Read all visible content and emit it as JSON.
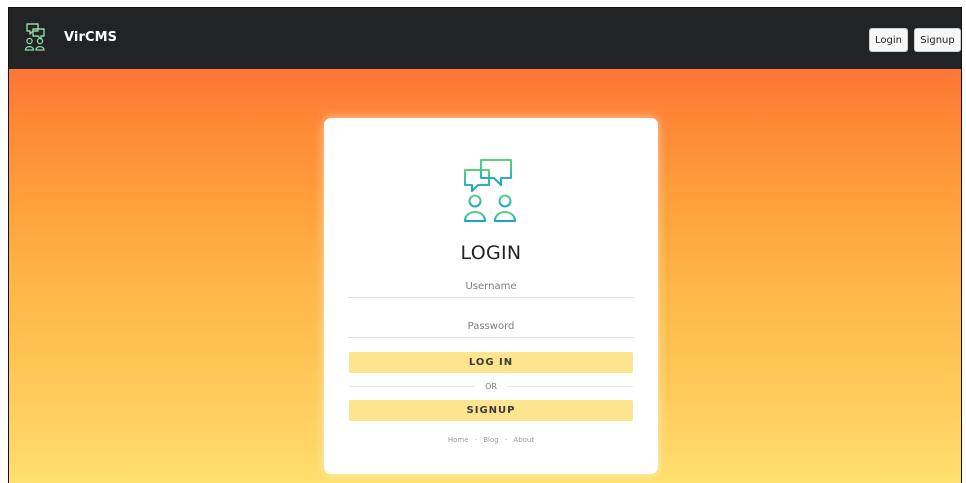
{
  "header": {
    "brand_name": "VirCMS",
    "login_label": "Login",
    "signup_label": "Signup"
  },
  "card": {
    "title": "LOGIN",
    "username_placeholder": "Username",
    "password_placeholder": "Password",
    "login_button": "LOG IN",
    "divider_text": "OR",
    "signup_button": "SIGNUP",
    "footer_links": [
      "Home",
      "Blog",
      "About"
    ],
    "footer_separator": "·"
  },
  "icons": {
    "brand": "chat-people-logo-icon",
    "card": "chat-people-logo-icon"
  },
  "colors": {
    "topbar": "#212325",
    "gradient_top": "#ff7537",
    "gradient_bottom": "#ffe070",
    "button": "#fde48f",
    "logo_green": "#4fd08a",
    "logo_teal": "#19a7c6"
  }
}
